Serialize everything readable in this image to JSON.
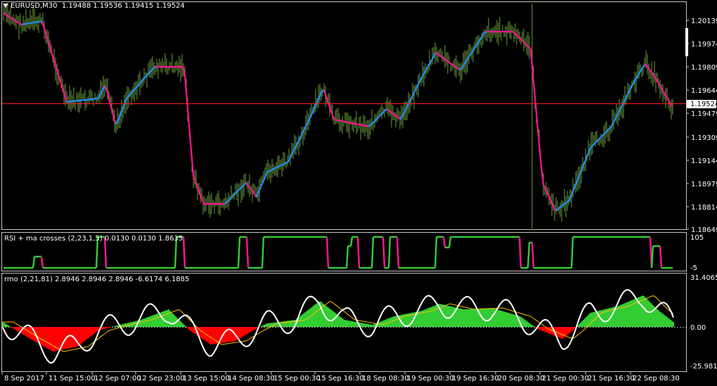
{
  "main": {
    "symbol": "EURUSD,M30",
    "ohlc": "1.19488 1.19536 1.19415 1.19524",
    "current_price": "1.19524",
    "price_scale": [
      "1.20139",
      "1.19974",
      "1.19809",
      "1.19644",
      "1.19479",
      "1.19309",
      "1.19144",
      "1.18979",
      "1.18814",
      "1.18649"
    ],
    "colors": {
      "bars": "#6b9b3a",
      "ma_up": "#1e90ff",
      "ma_down": "#ff1493",
      "price_line": "#ff2020"
    }
  },
  "rsi": {
    "title": "RSI + ma crosses (2,23,1,5) 0.0130 0.0130 1.8635",
    "scale": [
      "105",
      "-5"
    ],
    "colors": {
      "up": "#33cc33",
      "down": "#ff1493",
      "signal": "#ffffff"
    }
  },
  "rmo": {
    "title": "rmo (2,21,81) 2.8946 2.8946 2.8946 -6.6174 6.1885",
    "scale": [
      "31.4065",
      "0.00",
      "-25.9815"
    ],
    "colors": {
      "pos": "#33cc33",
      "neg": "#ff0000",
      "line": "#ffffff",
      "signal": "#ffc000"
    }
  },
  "time_axis": [
    "8 Sep 2017",
    "11 Sep 15:00",
    "12 Sep 07:00",
    "12 Sep 23:00",
    "13 Sep 15:00",
    "14 Sep 08:30",
    "15 Sep 00:30",
    "15 Sep 16:30",
    "18 Sep 08:30",
    "19 Sep 00:30",
    "19 Sep 16:30",
    "20 Sep 08:30",
    "21 Sep 00:30",
    "21 Sep 16:30",
    "22 Sep 08:30"
  ]
}
